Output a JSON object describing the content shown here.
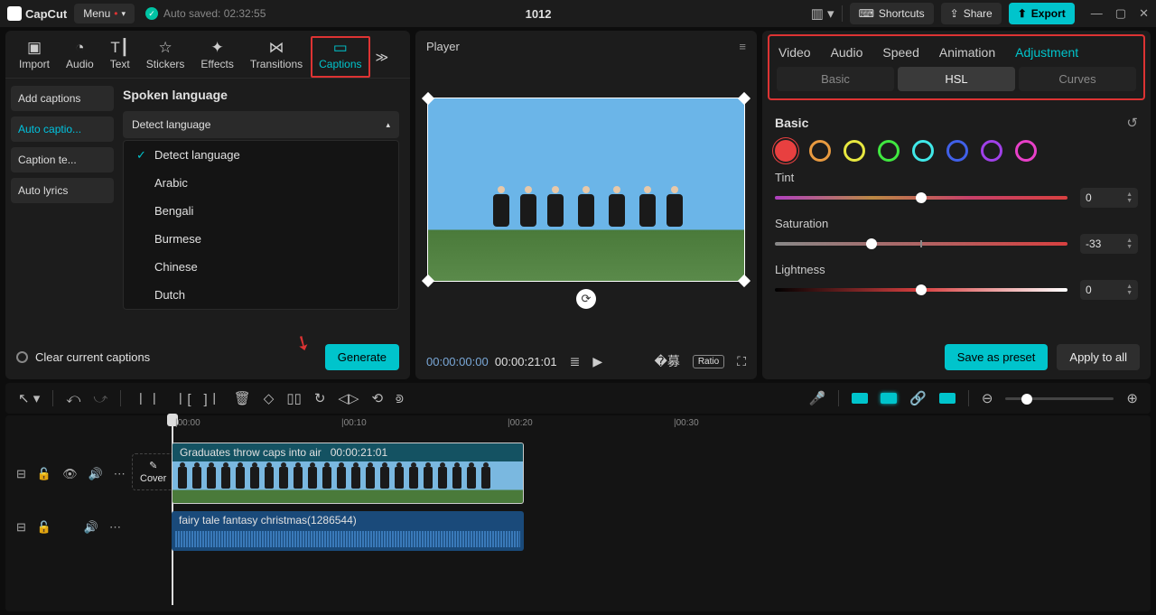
{
  "top": {
    "brand": "CapCut",
    "menu": "Menu",
    "autosave": "Auto saved: 02:32:55",
    "title": "1012",
    "shortcuts": "Shortcuts",
    "share": "Share",
    "export": "Export"
  },
  "leftTabs": {
    "items": [
      "Import",
      "Audio",
      "Text",
      "Stickers",
      "Effects",
      "Transitions",
      "Captions"
    ],
    "icons": [
      "▣",
      "◔",
      "T┃",
      "☆",
      "✦",
      "⋈",
      "▭"
    ]
  },
  "captionsSide": [
    "Add captions",
    "Auto captio...",
    "Caption te...",
    "Auto lyrics"
  ],
  "captionsPanel": {
    "title": "Spoken language",
    "selected": "Detect language",
    "options": [
      "Detect language",
      "Arabic",
      "Bengali",
      "Burmese",
      "Chinese",
      "Dutch"
    ],
    "clear": "Clear current captions",
    "generate": "Generate"
  },
  "player": {
    "title": "Player",
    "curTime": "00:00:00:00",
    "totalTime": "00:00:21:01",
    "ratio": "Ratio"
  },
  "right": {
    "tabs": [
      "Video",
      "Audio",
      "Speed",
      "Animation",
      "Adjustment"
    ],
    "subtabs": [
      "Basic",
      "HSL",
      "Curves"
    ],
    "basic": "Basic",
    "sliders": {
      "tint": {
        "label": "Tint",
        "value": "0"
      },
      "sat": {
        "label": "Saturation",
        "value": "-33"
      },
      "light": {
        "label": "Lightness",
        "value": "0"
      }
    },
    "colors": [
      "#e84040",
      "#e89a40",
      "#e8e840",
      "#40e840",
      "#40e8e8",
      "#4060e8",
      "#a040e8",
      "#e840c8"
    ],
    "savePreset": "Save as preset",
    "applyAll": "Apply to all"
  },
  "timeline": {
    "marks": [
      "00:00",
      "00:10",
      "00:20",
      "00:30"
    ],
    "cover": "Cover",
    "clip1": {
      "label": "Graduates throw caps into air",
      "time": "00:00:21:01"
    },
    "clip2": {
      "label": "fairy tale fantasy christmas(1286544)"
    }
  }
}
